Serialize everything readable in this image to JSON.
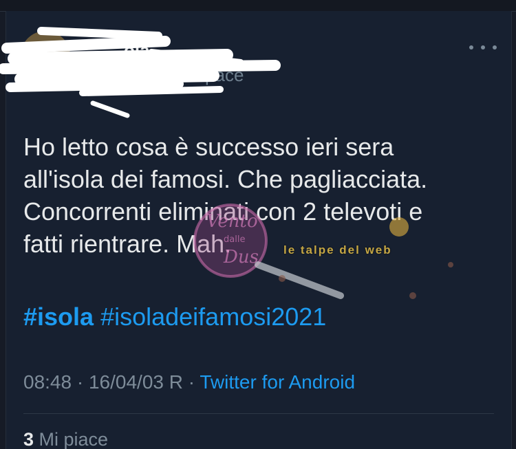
{
  "author": {
    "name": "ola",
    "handle": "...nonspace"
  },
  "tweet": {
    "lines": [
      "Ho letto cosa è successo ieri sera",
      "all'isola dei famosi. Che pagliacciata.",
      "Concorrenti eliminati con 2 televoti e",
      "fatti rientrare. Mah."
    ],
    "hashtags": [
      "#isola",
      "#isoladeifamosi2021"
    ]
  },
  "meta": {
    "time": "08:48",
    "separator1": " · ",
    "date": "16/04/03 R",
    "separator2": " · ",
    "source": "Twitter for Android"
  },
  "likes": {
    "count": "3",
    "label": " Mi piace"
  },
  "watermark": {
    "banner": "le talpe del web",
    "logo_text": [
      "Vento",
      "dalle",
      "Dus"
    ]
  },
  "icons": {
    "more": "more-horizontal-icon"
  },
  "colors": {
    "background": "#172030",
    "text": "#e7e9ea",
    "muted": "#7e8c99",
    "accent": "#1d9bf0"
  }
}
